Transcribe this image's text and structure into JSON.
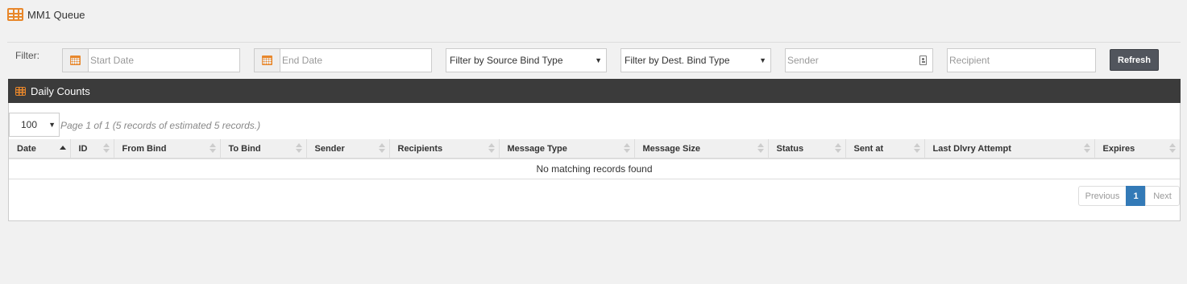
{
  "header": {
    "title": "MM1 Queue",
    "icon": "table-icon"
  },
  "filter": {
    "label": "Filter:",
    "start_date_placeholder": "Start Date",
    "end_date_placeholder": "End Date",
    "source_bind_select": "Filter by Source Bind Type",
    "dest_bind_select": "Filter by Dest. Bind Type",
    "sender_placeholder": "Sender",
    "recipient_placeholder": "Recipient",
    "refresh_label": "Refresh"
  },
  "panel": {
    "title": "Daily Counts",
    "page_size": "100",
    "page_info": "Page 1 of 1 (5 records of estimated 5 records.)",
    "columns": [
      "Date",
      "ID",
      "From Bind",
      "To Bind",
      "Sender",
      "Recipients",
      "Message Type",
      "Message Size",
      "Status",
      "Sent at",
      "Last Dlvry Attempt",
      "Expires"
    ],
    "empty_message": "No matching records found",
    "pagination": {
      "previous": "Previous",
      "current": "1",
      "next": "Next"
    }
  },
  "colors": {
    "accent": "#e8872b",
    "heading_bg": "#3b3b3b",
    "button_bg": "#51555d",
    "active_page": "#337ab7"
  }
}
